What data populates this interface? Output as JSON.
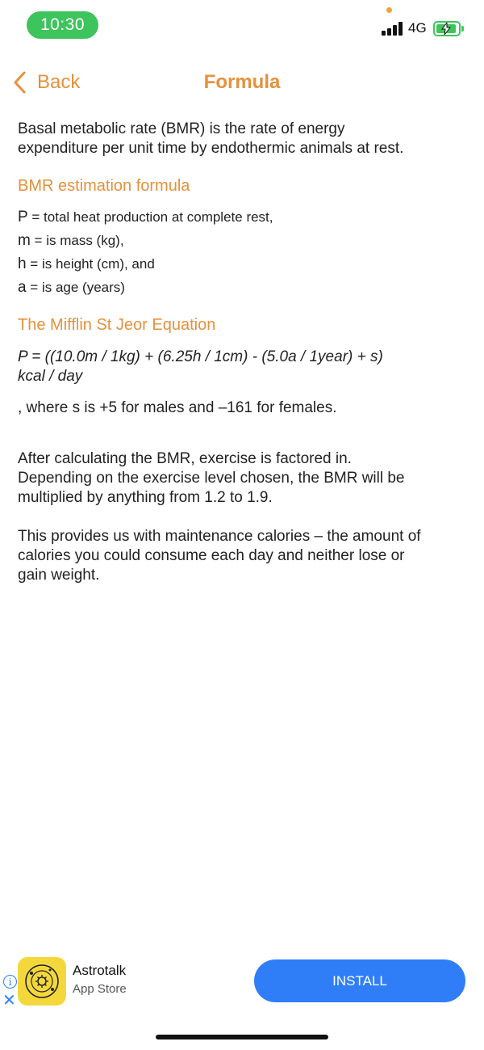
{
  "status_bar": {
    "time": "10:30",
    "network": "4G",
    "accent_color": "#3ec45c"
  },
  "nav": {
    "back_label": "Back",
    "title": "Formula",
    "accent_color": "#e6913c"
  },
  "content": {
    "intro_line1": "Basal metabolic rate (BMR) is the rate of energy",
    "intro_line2": "expenditure per unit time by endothermic animals at rest.",
    "bmr_heading": "BMR estimation formula",
    "variables": [
      {
        "symbol": "P",
        "desc": " = total heat production at complete rest,"
      },
      {
        "symbol": "m",
        "desc": " = is mass (kg),"
      },
      {
        "symbol": "h",
        "desc": " = is height (cm), and"
      },
      {
        "symbol": "a",
        "desc": " = is age (years)"
      }
    ],
    "mifflin_heading": "The Mifflin St Jeor Equation",
    "equation_line1": "P = ((10.0m / 1kg) + (6.25h / 1cm) - (5.0a / 1year) + s)",
    "equation_line2": "kcal / day",
    "where_text": ", where s is +5 for males and –161 for females.",
    "exercise_line1": "After calculating the BMR, exercise is factored in.",
    "exercise_line2": "Depending on the exercise level chosen, the BMR will be",
    "exercise_line3": "multiplied by anything from 1.2 to 1.9.",
    "maint_line1": "This provides us with maintenance calories – the amount of",
    "maint_line2": "calories you could consume each day and neither lose or",
    "maint_line3": "gain weight."
  },
  "ad": {
    "app_name": "Astrotalk",
    "store": "App Store",
    "install_label": "INSTALL",
    "info_icon": "info-icon",
    "close_icon": "close-icon",
    "button_color": "#2f7ef7"
  }
}
